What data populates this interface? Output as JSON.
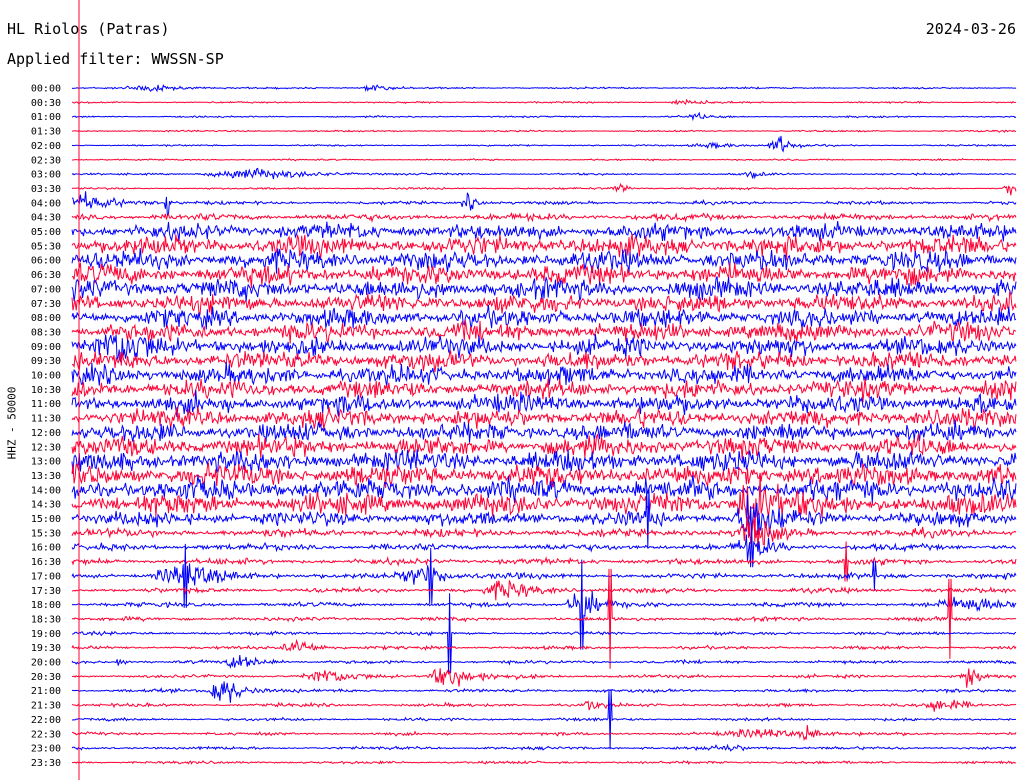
{
  "header": {
    "station": "HL Riolos (Patras)",
    "date": "2024-03-26",
    "filter": "Applied filter: WWSSN-SP"
  },
  "chart_data": {
    "type": "line",
    "title": "HL Riolos (Patras)",
    "subtitle": "Applied filter: WWSSN-SP",
    "ylabel": "HHZ - 50000",
    "xlabel": "",
    "row_labels": [
      "00:00",
      "00:30",
      "01:00",
      "01:30",
      "02:00",
      "02:30",
      "03:00",
      "03:30",
      "04:00",
      "04:30",
      "05:00",
      "05:30",
      "06:00",
      "06:30",
      "07:00",
      "07:30",
      "08:00",
      "08:30",
      "09:00",
      "09:30",
      "10:00",
      "10:30",
      "11:00",
      "11:30",
      "12:00",
      "12:30",
      "13:00",
      "13:30",
      "14:00",
      "14:30",
      "15:00",
      "15:30",
      "16:00",
      "16:30",
      "17:00",
      "17:30",
      "18:00",
      "18:30",
      "19:00",
      "19:30",
      "20:00",
      "20:30",
      "21:00",
      "21:30",
      "22:00",
      "22:30",
      "23:00",
      "23:30"
    ],
    "series_colors": [
      "#0000ff",
      "#ff0033"
    ],
    "noise_amplitude": [
      0.6,
      0.6,
      0.6,
      0.6,
      0.6,
      0.6,
      0.7,
      0.7,
      1.2,
      2.5,
      6,
      7.5,
      7.5,
      7.5,
      7.5,
      7,
      7,
      7,
      7,
      7,
      7,
      7,
      7,
      7,
      7,
      7.5,
      8,
      8.5,
      8.5,
      8,
      5.5,
      3,
      2.4,
      2.2,
      2,
      1.8,
      1.6,
      1.4,
      1.2,
      1.2,
      1.2,
      1.2,
      1.2,
      1.2,
      1.1,
      1.1,
      1.1,
      1.0
    ],
    "events": [
      {
        "row": 0,
        "x": 0.08,
        "amp": 3,
        "width": 0.03
      },
      {
        "row": 0,
        "x": 0.32,
        "amp": 2,
        "width": 0.02
      },
      {
        "row": 1,
        "x": 0.65,
        "amp": 2,
        "width": 0.02
      },
      {
        "row": 2,
        "x": 0.66,
        "amp": 2,
        "width": 0.02
      },
      {
        "row": 4,
        "x": 0.75,
        "amp": 6,
        "width": 0.015
      },
      {
        "row": 4,
        "x": 0.68,
        "amp": 2,
        "width": 0.03
      },
      {
        "row": 6,
        "x": 0.19,
        "amp": 4,
        "width": 0.06
      },
      {
        "row": 6,
        "x": 0.72,
        "amp": 3,
        "width": 0.01
      },
      {
        "row": 7,
        "x": 0.58,
        "amp": 4,
        "width": 0.01
      },
      {
        "row": 7,
        "x": 0.995,
        "amp": 5,
        "width": 0.01
      },
      {
        "row": 8,
        "x": 0.01,
        "amp": 6,
        "width": 0.04
      },
      {
        "row": 8,
        "x": 0.42,
        "amp": 6,
        "width": 0.01
      },
      {
        "row": 8,
        "x": 0.1,
        "amp": 35,
        "width": 0.002
      },
      {
        "row": 18,
        "x": 0.05,
        "amp": 10,
        "width": 0.03
      },
      {
        "row": 29,
        "x": 0.72,
        "amp": 25,
        "width": 0.02
      },
      {
        "row": 30,
        "x": 0.72,
        "amp": 20,
        "width": 0.02
      },
      {
        "row": 31,
        "x": 0.72,
        "amp": 14,
        "width": 0.02
      },
      {
        "row": 32,
        "x": 0.72,
        "amp": 10,
        "width": 0.02
      },
      {
        "row": 34,
        "x": 0.12,
        "amp": 8,
        "width": 0.04
      },
      {
        "row": 34,
        "x": 0.37,
        "amp": 7,
        "width": 0.03
      },
      {
        "row": 35,
        "x": 0.46,
        "amp": 6,
        "width": 0.03
      },
      {
        "row": 36,
        "x": 0.54,
        "amp": 12,
        "width": 0.02
      },
      {
        "row": 36,
        "x": 0.95,
        "amp": 5,
        "width": 0.05
      },
      {
        "row": 39,
        "x": 0.24,
        "amp": 6,
        "width": 0.02
      },
      {
        "row": 40,
        "x": 0.18,
        "amp": 6,
        "width": 0.02
      },
      {
        "row": 40,
        "x": 0.05,
        "amp": 8,
        "width": 0.004
      },
      {
        "row": 41,
        "x": 0.27,
        "amp": 5,
        "width": 0.03
      },
      {
        "row": 41,
        "x": 0.4,
        "amp": 8,
        "width": 0.03
      },
      {
        "row": 41,
        "x": 0.95,
        "amp": 10,
        "width": 0.01
      },
      {
        "row": 42,
        "x": 0.16,
        "amp": 12,
        "width": 0.02
      },
      {
        "row": 43,
        "x": 0.55,
        "amp": 4,
        "width": 0.01
      },
      {
        "row": 43,
        "x": 0.92,
        "amp": 6,
        "width": 0.02
      },
      {
        "row": 45,
        "x": 0.78,
        "amp": 6,
        "width": 0.01
      },
      {
        "row": 45,
        "x": 0.73,
        "amp": 3,
        "width": 0.05
      },
      {
        "row": 46,
        "x": 0.69,
        "amp": 2,
        "width": 0.03
      }
    ],
    "spikes": [
      {
        "row": 34,
        "x": 0.12,
        "amp": 32
      },
      {
        "row": 34,
        "x": 0.38,
        "amp": 28
      },
      {
        "row": 36,
        "x": 0.54,
        "amp": 45
      },
      {
        "row": 37,
        "x": 0.57,
        "amp": 50
      },
      {
        "row": 37,
        "x": 0.93,
        "amp": 40
      },
      {
        "row": 38,
        "x": 0.4,
        "amp": 40
      },
      {
        "row": 30,
        "x": 0.61,
        "amp": 30
      },
      {
        "row": 44,
        "x": 0.57,
        "amp": 30
      },
      {
        "row": 32,
        "x": 0.72,
        "amp": 20
      },
      {
        "row": 33,
        "x": 0.82,
        "amp": 20
      },
      {
        "row": 34,
        "x": 0.85,
        "amp": 15
      }
    ]
  }
}
